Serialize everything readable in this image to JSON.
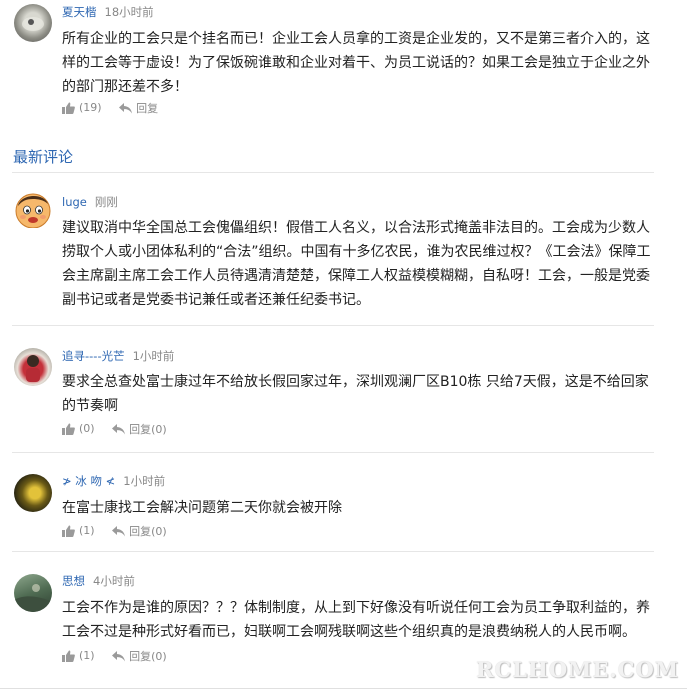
{
  "top_comment": {
    "username": "夏天楷",
    "time": "18小时前",
    "text": "所有企业的工会只是个挂名而已！企业工会人员拿的工资是企业发的，又不是第三者介入的，这样的工会等于虚设！为了保饭碗谁敢和企业对着干、为员工说话的？如果工会是独立于企业之外的部门那还差不多！",
    "likes": "(19)",
    "reply_label": "回复"
  },
  "section_title": "最新评论",
  "comments": [
    {
      "username": "luge",
      "time": "刚刚",
      "text": "建议取消中华全国总工会傀儡组织！假借工人名义，以合法形式掩盖非法目的。工会成为少数人捞取个人或小团体私利的“合法”组织。中国有十多亿农民，谁为农民维过权？《工会法》保障工会主席副主席工会工作人员待遇清清楚楚，保障工人权益模模糊糊，自私呀！工会，一般是党委副书记或者是党委书记兼任或者还兼任纪委书记。"
    },
    {
      "username": "追寻----光芒",
      "time": "1小时前",
      "text": "要求全总查处富士康过年不给放长假回家过年，深圳观澜厂区B10栋 只给7天假，这是不给回家的节奏啊",
      "likes": "(0)",
      "reply_label": "回复",
      "replies": "(0)"
    },
    {
      "username": "≯ 冰 吻 ≮",
      "time": "1小时前",
      "text": "在富士康找工会解决问题第二天你就会被开除",
      "likes": "(1)",
      "reply_label": "回复",
      "replies": "(0)"
    },
    {
      "username": "思想",
      "time": "4小时前",
      "text": "工会不作为是谁的原因？？？体制制度，从上到下好像没有听说任何工会为员工争取利益的，养工会不过是种形式好看而已，妇联啊工会啊残联啊这些个组织真的是浪费纳税人的人民币啊。",
      "likes": "(1)",
      "reply_label": "回复",
      "replies": "(0)"
    }
  ],
  "watermark": "RCLHOME.COM",
  "colors": {
    "link_blue": "#2e67b2",
    "meta_gray": "#888888",
    "divider": "#e6e6e6"
  },
  "icons": [
    "thumbs-up-icon",
    "reply-arrow-icon"
  ]
}
